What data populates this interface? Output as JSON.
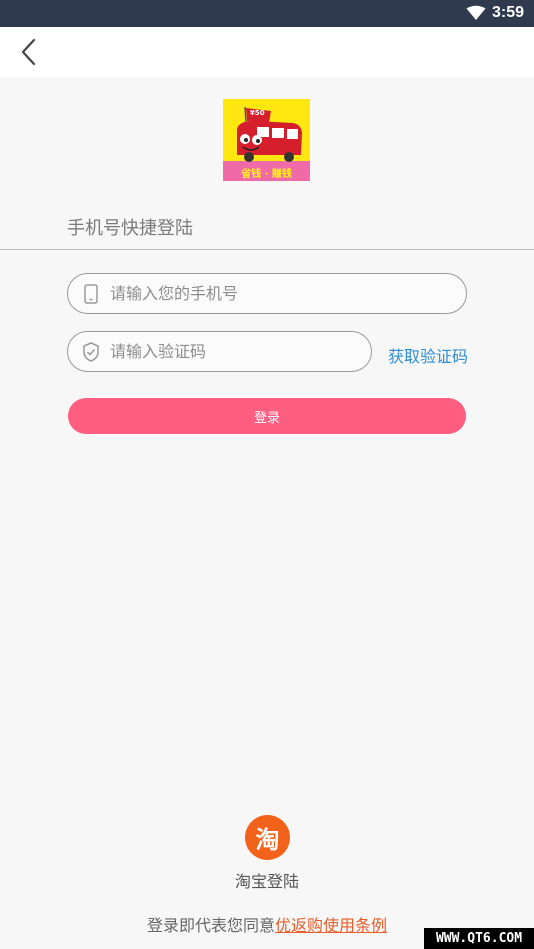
{
  "status_bar": {
    "time": "3:59",
    "wifi_icon": "wifi-icon"
  },
  "top_bar": {
    "back_icon": "chevron-left-icon"
  },
  "logo": {
    "badge": "¥50",
    "tagline": "省钱 · 赚钱",
    "colors": {
      "background": "#ffe812",
      "bus": "#d61f2c"
    }
  },
  "login": {
    "title": "手机号快捷登陆",
    "phone_placeholder": "请输入您的手机号",
    "code_placeholder": "请输入验证码",
    "get_code_label": "获取验证码",
    "submit_label": "登录"
  },
  "alt_login": {
    "icon_glyph": "淘",
    "label": "淘宝登陆"
  },
  "agreement": {
    "prefix": "登录即代表您同意",
    "link": "优返购使用条例"
  },
  "watermark": {
    "text": "WWW.QT6.COM"
  },
  "colors": {
    "accent": "#ff5e80",
    "link": "#2e8dd6",
    "taobao": "#f2621a",
    "terms": "#e85d2a"
  }
}
